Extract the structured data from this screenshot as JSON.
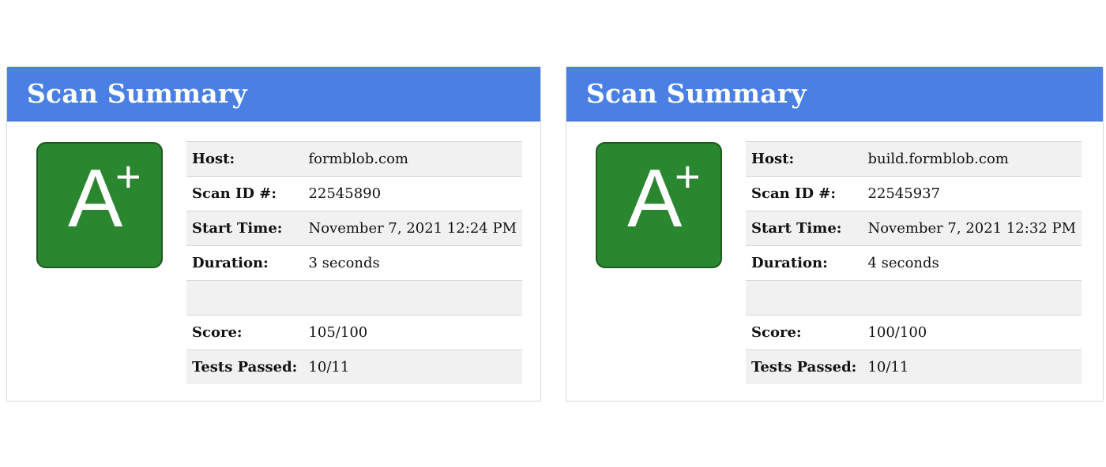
{
  "panels": [
    {
      "title": "Scan Summary",
      "grade": {
        "letter": "A",
        "modifier": "+"
      },
      "rows": [
        {
          "label": "Host:",
          "value": "formblob.com"
        },
        {
          "label": "Scan ID #:",
          "value": "22545890"
        },
        {
          "label": "Start Time:",
          "value": "November 7, 2021 12:24 PM"
        },
        {
          "label": "Duration:",
          "value": "3 seconds"
        },
        {
          "label": "",
          "value": ""
        },
        {
          "label": "Score:",
          "value": "105/100"
        },
        {
          "label": "Tests Passed:",
          "value": "10/11"
        }
      ]
    },
    {
      "title": "Scan Summary",
      "grade": {
        "letter": "A",
        "modifier": "+"
      },
      "rows": [
        {
          "label": "Host:",
          "value": "build.formblob.com"
        },
        {
          "label": "Scan ID #:",
          "value": "22545937"
        },
        {
          "label": "Start Time:",
          "value": "November 7, 2021 12:32 PM"
        },
        {
          "label": "Duration:",
          "value": "4 seconds"
        },
        {
          "label": "",
          "value": ""
        },
        {
          "label": "Score:",
          "value": "100/100"
        },
        {
          "label": "Tests Passed:",
          "value": "10/11"
        }
      ]
    }
  ],
  "colors": {
    "header": "#4a80e4",
    "grade_box": "#2a862f",
    "row_stripe": "#f1f1f1"
  }
}
